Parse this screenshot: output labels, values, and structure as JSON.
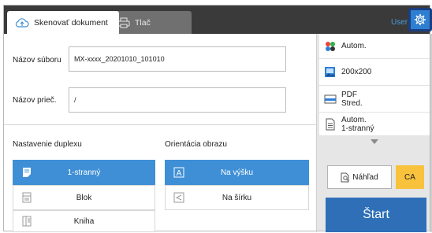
{
  "header": {
    "tabs": [
      {
        "label": "Skenovať dokument",
        "icon": "cloud-upload-icon",
        "active": true
      },
      {
        "label": "Tlač",
        "icon": "printer-icon",
        "active": false
      }
    ],
    "user_label": "User",
    "settings_icon": "gear-icon"
  },
  "fields": {
    "file_name": {
      "label": "Názov súboru",
      "value": "MX-xxxx_20201010_101010"
    },
    "folder_name": {
      "label": "Názov prieč.",
      "value": "/"
    }
  },
  "duplex": {
    "title": "Nastavenie duplexu",
    "options": [
      {
        "label": "1-stranný",
        "selected": true
      },
      {
        "label": "Blok",
        "selected": false
      },
      {
        "label": "Kniha",
        "selected": false
      }
    ]
  },
  "orientation": {
    "title": "Orientácia obrazu",
    "options": [
      {
        "label": "Na výšku",
        "selected": true
      },
      {
        "label": "Na šírku",
        "selected": false
      }
    ]
  },
  "right_panel": {
    "color_mode": "Autom.",
    "resolution": "200x200",
    "file_format_line1": "PDF",
    "file_format_line2": "Stred.",
    "duplex_line1": "Autom.",
    "duplex_line2": "1-stranný",
    "preview_label": "Náhľad",
    "ca_label": "CA",
    "start_label": "Štart"
  },
  "colors": {
    "accent": "#3f8fd6",
    "start": "#2e6fb8",
    "ca": "#f9c23c",
    "header_bg": "#3a3a3a",
    "settings_highlight": "#1a3e82"
  }
}
